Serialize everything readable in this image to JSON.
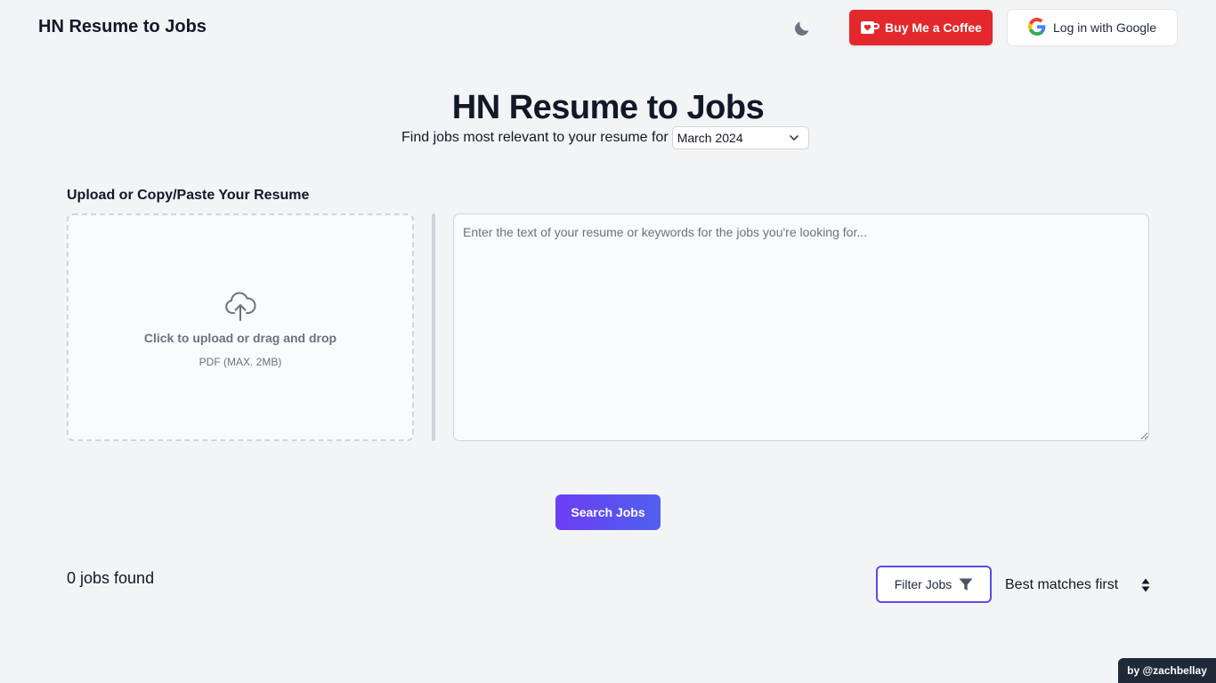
{
  "header": {
    "site_title": "HN Resume to Jobs",
    "theme_toggle_icon": "moon-icon",
    "coffee_label": "Buy Me a Coffee",
    "google_login_label": "Log in with Google"
  },
  "hero": {
    "title": "HN Resume to Jobs",
    "subtitle": "Find jobs most relevant to your resume for",
    "selected_month": "March 2024"
  },
  "upload": {
    "heading": "Upload or Copy/Paste Your Resume",
    "dropzone_main": "Click to upload or drag and drop",
    "dropzone_sub": "PDF (MAX. 2MB)",
    "textarea_value": "",
    "textarea_placeholder": "Enter the text of your resume or keywords for the jobs you're looking for..."
  },
  "actions": {
    "search_label": "Search Jobs"
  },
  "results": {
    "jobs_found": "0 jobs found",
    "filter_label": "Filter Jobs",
    "sort_label": "Best matches first"
  },
  "footer": {
    "credit": "by @zachbellay"
  },
  "colors": {
    "background": "#f3f4f6",
    "coffee_red": "#e3282d",
    "accent_purple": "#6d3df5",
    "accent_blue": "#4f60ee",
    "credit_bg": "#1f2937"
  }
}
